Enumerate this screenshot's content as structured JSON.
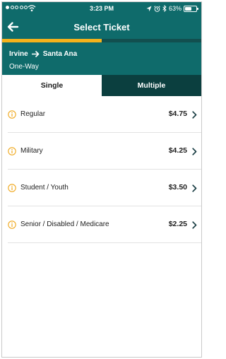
{
  "status": {
    "time": "3:23 PM",
    "battery": "63%",
    "battery_level": 0.63
  },
  "header": {
    "title": "Select Ticket",
    "progress": 0.5
  },
  "route": {
    "origin": "Irvine",
    "destination": "Santa Ana",
    "trip_type": "One-Way"
  },
  "tabs": [
    {
      "label": "Single",
      "active": true
    },
    {
      "label": "Multiple",
      "active": false
    }
  ],
  "tickets": [
    {
      "label": "Regular",
      "price": "$4.75"
    },
    {
      "label": "Military",
      "price": "$4.25"
    },
    {
      "label": "Student / Youth",
      "price": "$3.50"
    },
    {
      "label": "Senior / Disabled / Medicare",
      "price": "$2.25"
    }
  ],
  "colors": {
    "primary": "#0f6b6b",
    "tab_inactive": "#0b3f3f",
    "accent": "#f5b21b"
  }
}
